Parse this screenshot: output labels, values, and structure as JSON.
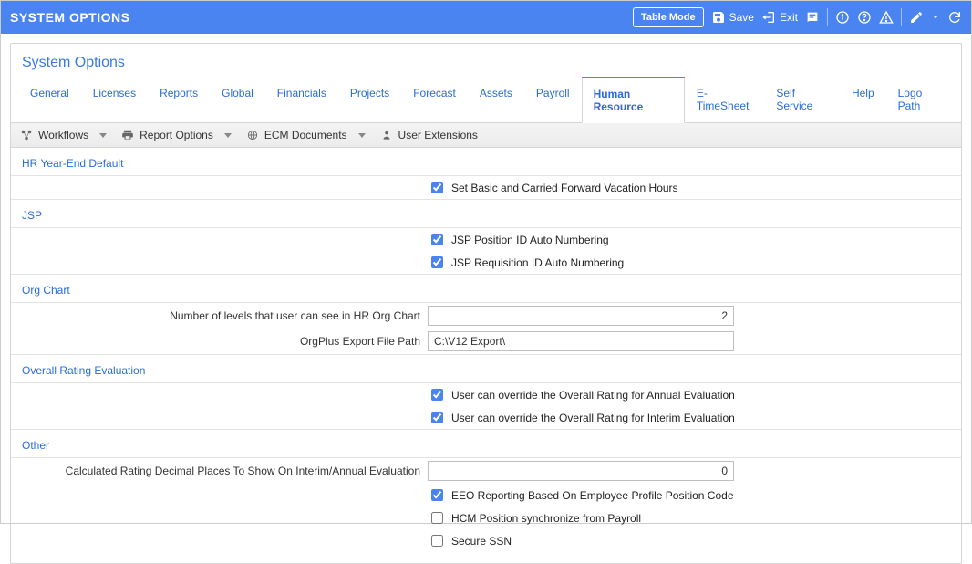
{
  "header": {
    "title": "SYSTEM OPTIONS",
    "table_mode": "Table Mode",
    "save": "Save",
    "exit": "Exit"
  },
  "card_title": "System Options",
  "tabs": {
    "general": "General",
    "licenses": "Licenses",
    "reports": "Reports",
    "global": "Global",
    "financials": "Financials",
    "projects": "Projects",
    "forecast": "Forecast",
    "assets": "Assets",
    "payroll": "Payroll",
    "human_resource": "Human Resource",
    "etimesheet": "E-TimeSheet",
    "self_service": "Self Service",
    "help": "Help",
    "logo_path": "Logo Path"
  },
  "toolbar": {
    "workflows": "Workflows",
    "report_options": "Report Options",
    "ecm_documents": "ECM Documents",
    "user_extensions": "User Extensions"
  },
  "sections": {
    "hr_year_end": "HR Year-End Default",
    "jsp": "JSP",
    "org_chart": "Org Chart",
    "overall_rating": "Overall Rating Evaluation",
    "other": "Other"
  },
  "fields": {
    "set_basic_vac": "Set Basic and Carried Forward Vacation Hours",
    "jsp_position": "JSP Position ID Auto Numbering",
    "jsp_requisition": "JSP Requisition ID Auto Numbering",
    "levels_label": "Number of levels that user can see in HR Org Chart",
    "levels_value": "2",
    "orgplus_label": "OrgPlus Export File Path",
    "orgplus_value": "C:\\V12 Export\\",
    "override_annual": "User can override the Overall Rating for Annual Evaluation",
    "override_interim": "User can override the Overall Rating for Interim Evaluation",
    "calc_rating_label": "Calculated Rating Decimal Places To Show On Interim/Annual Evaluation",
    "calc_rating_value": "0",
    "eeo_reporting": "EEO Reporting Based On Employee Profile Position Code",
    "hcm_sync": "HCM Position synchronize from Payroll",
    "secure_ssn": "Secure SSN"
  }
}
